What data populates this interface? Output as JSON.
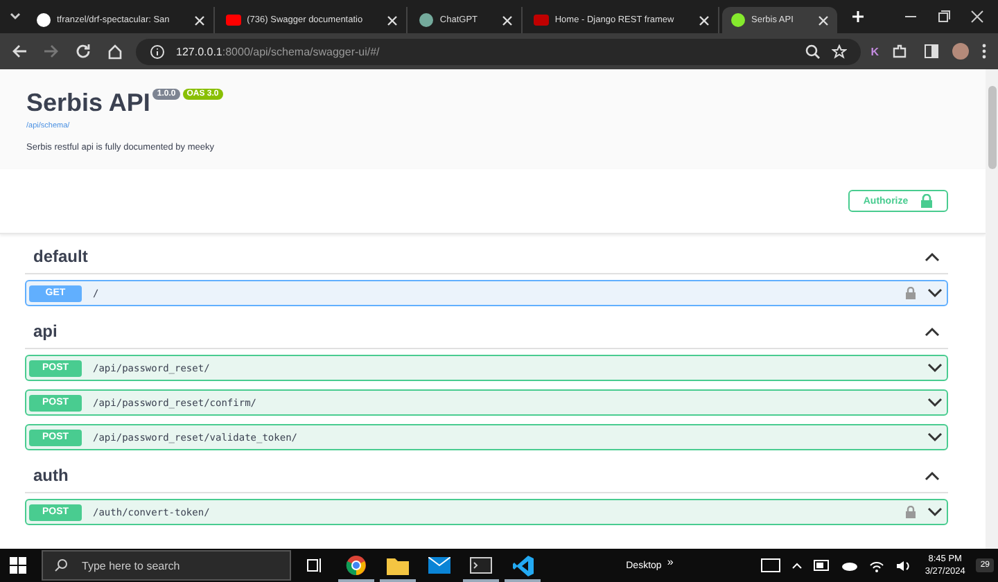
{
  "tabs": [
    {
      "title": "tfranzel/drf-spectacular: San",
      "kind": "github",
      "selected": false
    },
    {
      "title": "(736) Swagger documentatio",
      "kind": "youtube",
      "selected": false
    },
    {
      "title": "ChatGPT",
      "kind": "chatgpt",
      "selected": false
    },
    {
      "title": "Home - Django REST framew",
      "kind": "django",
      "selected": false
    },
    {
      "title": "Serbis API",
      "kind": "swagger",
      "selected": true
    }
  ],
  "address": {
    "host": "127.0.0.1",
    "path": ":8000/api/schema/swagger-ui/#/"
  },
  "profile_letter": "K",
  "info": {
    "title": "Serbis API",
    "version": "1.0.0",
    "oas": "OAS 3.0",
    "schema_link": "/api/schema/",
    "description": "Serbis restful api is fully documented by meeky"
  },
  "authorize": "Authorize",
  "sections": [
    {
      "name": "default",
      "expanded": true,
      "ops": [
        {
          "method": "GET",
          "path": "/",
          "locked": true
        }
      ]
    },
    {
      "name": "api",
      "expanded": true,
      "ops": [
        {
          "method": "POST",
          "path": "/api/password_reset/",
          "locked": false
        },
        {
          "method": "POST",
          "path": "/api/password_reset/confirm/",
          "locked": false
        },
        {
          "method": "POST",
          "path": "/api/password_reset/validate_token/",
          "locked": false
        }
      ]
    },
    {
      "name": "auth",
      "expanded": true,
      "ops": [
        {
          "method": "POST",
          "path": "/auth/convert-token/",
          "locked": true
        }
      ]
    }
  ],
  "taskbar": {
    "search_placeholder": "Type here to search",
    "desktop": "Desktop",
    "chevron": "»",
    "time": "8:45 PM",
    "date": "3/27/2024",
    "notifications": "29"
  }
}
